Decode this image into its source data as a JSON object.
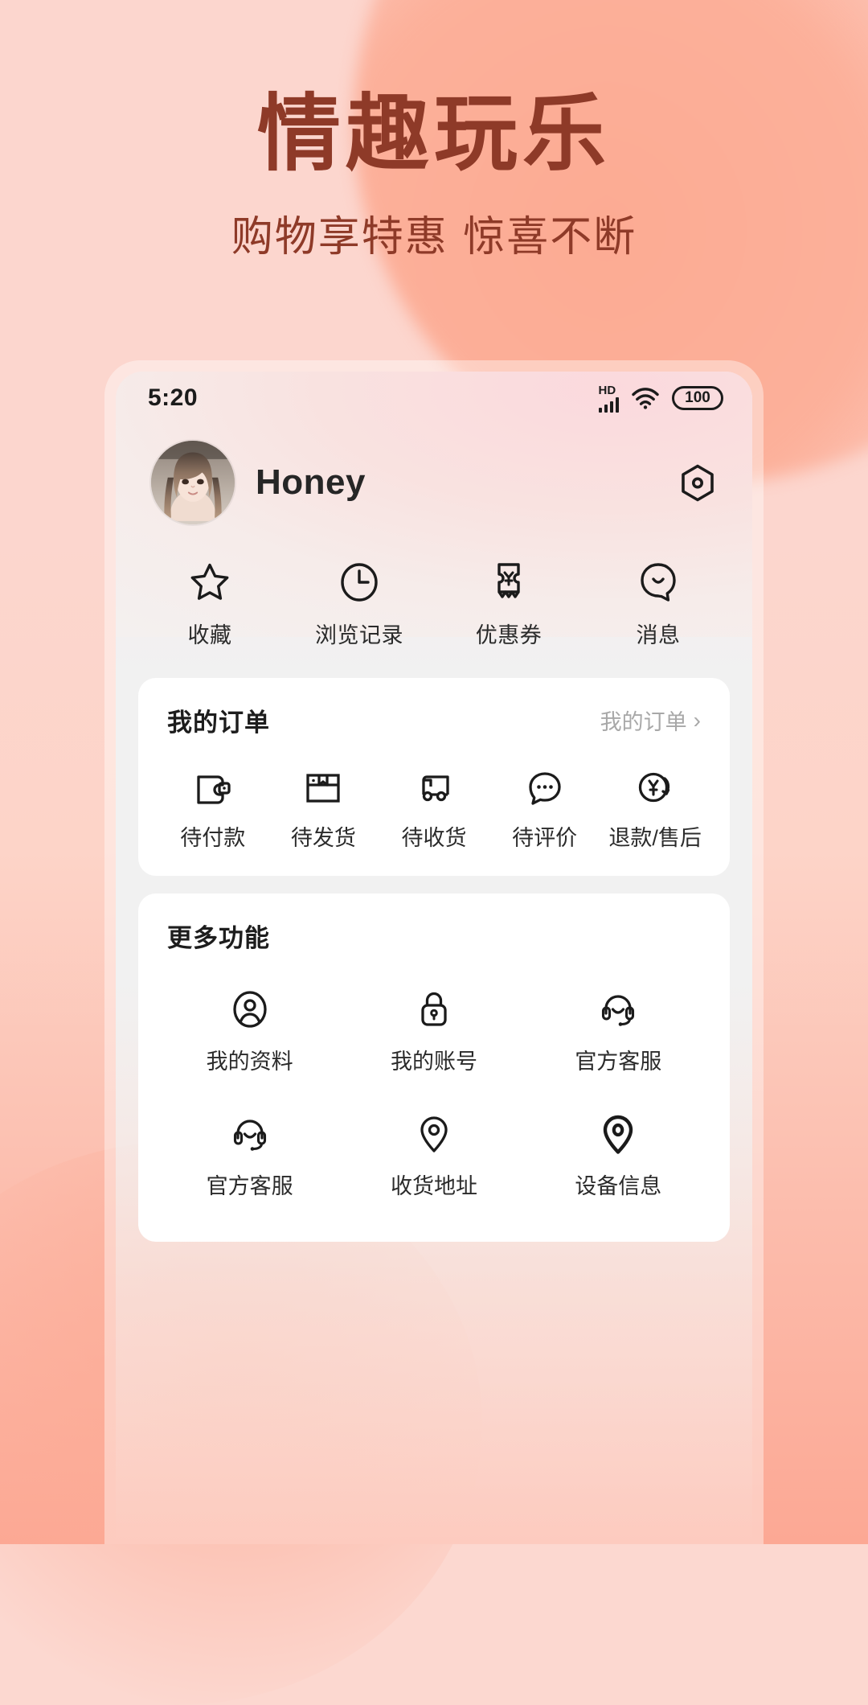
{
  "hero": {
    "title": "情趣玩乐",
    "subtitle": "购物享特惠 惊喜不断",
    "title_color": "#8e3a28"
  },
  "theme": {
    "page_bg_top": "#fcd6ce",
    "page_bg_bottom": "#fca894",
    "accent": "#8e3a28",
    "card_bg": "#ffffff",
    "screen_bg": "#f1f1f1"
  },
  "status_bar": {
    "time": "5:20",
    "network_label": "HD",
    "signal_icon": "signal-bars-icon",
    "wifi_icon": "wifi-icon",
    "battery_level": "100"
  },
  "profile": {
    "name": "Honey",
    "avatar_icon": "user-avatar-photo",
    "settings_icon": "hexagon-settings-icon"
  },
  "quick_actions": [
    {
      "label": "收藏",
      "icon": "star-icon"
    },
    {
      "label": "浏览记录",
      "icon": "clock-icon"
    },
    {
      "label": "优惠券",
      "icon": "coupon-yuan-icon"
    },
    {
      "label": "消息",
      "icon": "smile-bubble-icon"
    }
  ],
  "orders": {
    "title": "我的订单",
    "more_label": "我的订单",
    "more_chevron": "›",
    "items": [
      {
        "label": "待付款",
        "icon": "wallet-icon"
      },
      {
        "label": "待发货",
        "icon": "box-icon"
      },
      {
        "label": "待收货",
        "icon": "truck-icon"
      },
      {
        "label": "待评价",
        "icon": "comment-dots-icon"
      },
      {
        "label": "退款/售后",
        "icon": "refund-yuan-icon"
      }
    ]
  },
  "more_features": {
    "title": "更多功能",
    "items": [
      {
        "label": "我的资料",
        "icon": "person-circle-icon"
      },
      {
        "label": "我的账号",
        "icon": "lock-icon"
      },
      {
        "label": "官方客服",
        "icon": "headset-icon"
      },
      {
        "label": "官方客服",
        "icon": "headset-icon"
      },
      {
        "label": "收货地址",
        "icon": "map-pin-outline-icon"
      },
      {
        "label": "设备信息",
        "icon": "map-pin-icon"
      }
    ]
  }
}
